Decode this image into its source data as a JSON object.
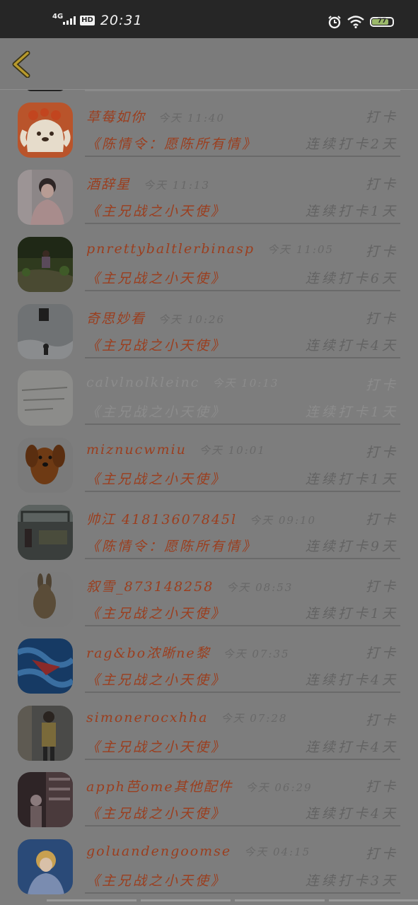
{
  "status_bar": {
    "network": "4G",
    "hd": "HD",
    "time": "20:31",
    "battery": "77"
  },
  "entries": [
    {
      "name": "草莓如你",
      "time": "今天 11:40",
      "action": "打卡",
      "book": "《陈情令：愿陈所有情》",
      "streak": "连续打卡2天"
    },
    {
      "name": "酒辞星",
      "time": "今天 11:13",
      "action": "打卡",
      "book": "《主兄战之小天使》",
      "streak": "连续打卡1天"
    },
    {
      "name": "pnrettybaltlerbinasp",
      "time": "今天 11:05",
      "action": "打卡",
      "book": "《主兄战之小天使》",
      "streak": "连续打卡6天"
    },
    {
      "name": "奇思妙看",
      "time": "今天 10:26",
      "action": "打卡",
      "book": "《主兄战之小天使》",
      "streak": "连续打卡4天"
    },
    {
      "name": "calvlnolkleinc",
      "time": "今天 10:13",
      "action": "打卡",
      "book": "《主兄战之小天使》",
      "streak": "连续打卡1天"
    },
    {
      "name": "miznucwmiu",
      "time": "今天 10:01",
      "action": "打卡",
      "book": "《主兄战之小天使》",
      "streak": "连续打卡1天"
    },
    {
      "name": "帅江 41813607845l",
      "time": "今天 09:10",
      "action": "打卡",
      "book": "《陈情令：愿陈所有情》",
      "streak": "连续打卡9天"
    },
    {
      "name": "叙雪_873148258",
      "time": "今天 08:53",
      "action": "打卡",
      "book": "《主兄战之小天使》",
      "streak": "连续打卡1天"
    },
    {
      "name": "rag&bo浓晰ne黎",
      "time": "今天 07:35",
      "action": "打卡",
      "book": "《主兄战之小天使》",
      "streak": "连续打卡4天"
    },
    {
      "name": "simonerocxhha",
      "time": "今天 07:28",
      "action": "打卡",
      "book": "《主兄战之小天使》",
      "streak": "连续打卡4天"
    },
    {
      "name": "apph芭ome其他配件",
      "time": "今天 06:29",
      "action": "打卡",
      "book": "《主兄战之小天使》",
      "streak": "连续打卡4天"
    },
    {
      "name": "goluandengoomse",
      "time": "今天 04:15",
      "action": "打卡",
      "book": "《主兄战之小天使》",
      "streak": "连续打卡3天"
    }
  ]
}
